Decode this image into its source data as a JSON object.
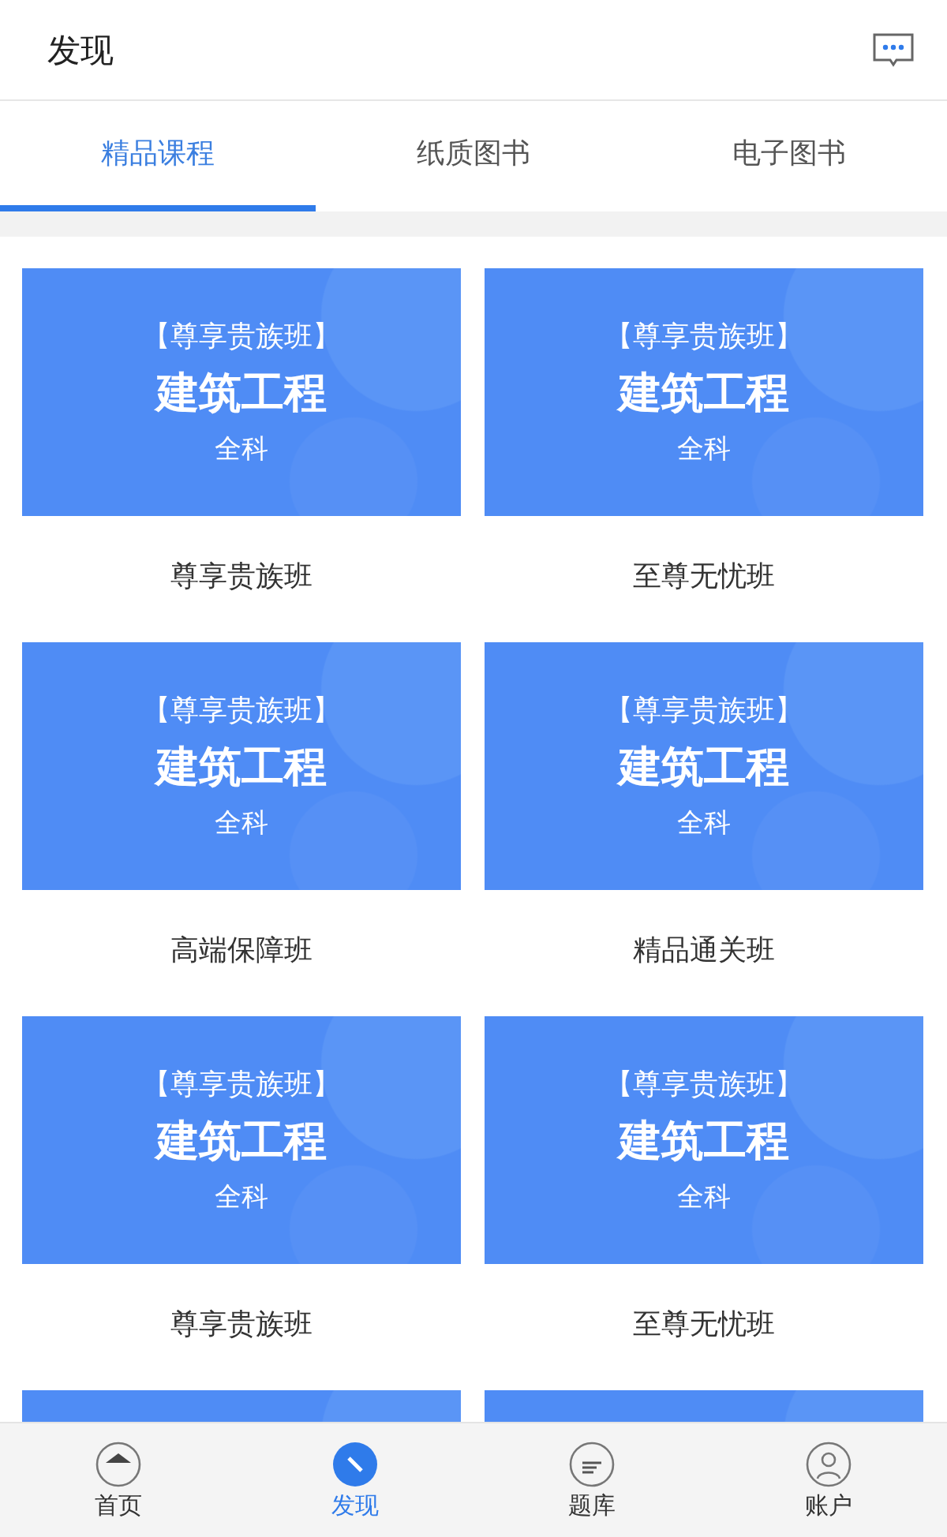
{
  "header": {
    "title": "发现"
  },
  "tabs": [
    {
      "label": "精品课程",
      "selected": true
    },
    {
      "label": "纸质图书",
      "selected": false
    },
    {
      "label": "电子图书",
      "selected": false
    }
  ],
  "courses": [
    {
      "banner_tag": "【尊享贵族班】",
      "banner_title": "建筑工程",
      "banner_subtitle": "全科",
      "name": "尊享贵族班"
    },
    {
      "banner_tag": "【尊享贵族班】",
      "banner_title": "建筑工程",
      "banner_subtitle": "全科",
      "name": "至尊无忧班"
    },
    {
      "banner_tag": "【尊享贵族班】",
      "banner_title": "建筑工程",
      "banner_subtitle": "全科",
      "name": "高端保障班"
    },
    {
      "banner_tag": "【尊享贵族班】",
      "banner_title": "建筑工程",
      "banner_subtitle": "全科",
      "name": "精品通关班"
    },
    {
      "banner_tag": "【尊享贵族班】",
      "banner_title": "建筑工程",
      "banner_subtitle": "全科",
      "name": "尊享贵族班"
    },
    {
      "banner_tag": "【尊享贵族班】",
      "banner_title": "建筑工程",
      "banner_subtitle": "全科",
      "name": "至尊无忧班"
    }
  ],
  "bottom_nav": [
    {
      "label": "首页",
      "kind": "home",
      "selected": false
    },
    {
      "label": "发现",
      "kind": "discover",
      "selected": true
    },
    {
      "label": "题库",
      "kind": "questions",
      "selected": false
    },
    {
      "label": "账户",
      "kind": "account",
      "selected": false
    }
  ]
}
